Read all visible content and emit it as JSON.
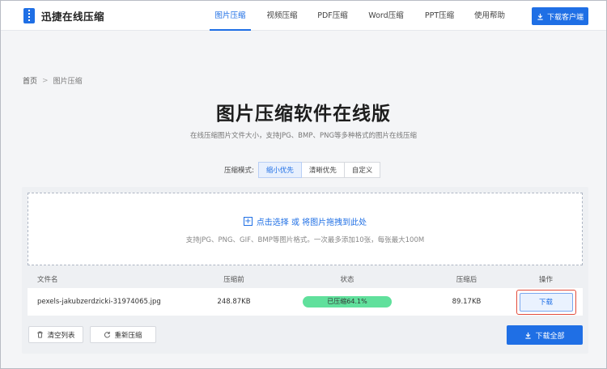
{
  "header": {
    "logo_text": "迅捷在线压缩",
    "nav": [
      {
        "label": "图片压缩",
        "active": true
      },
      {
        "label": "视频压缩",
        "active": false
      },
      {
        "label": "PDF压缩",
        "active": false
      },
      {
        "label": "Word压缩",
        "active": false
      },
      {
        "label": "PPT压缩",
        "active": false
      },
      {
        "label": "使用帮助",
        "active": false
      }
    ],
    "download_client_label": "下载客户端"
  },
  "breadcrumb": {
    "home": "首页",
    "separator": ">",
    "current": "图片压缩"
  },
  "page_title": "图片压缩软件在线版",
  "subtitle": "在线压缩图片文件大小，支持JPG、BMP、PNG等多种格式的图片在线压缩",
  "mode": {
    "label": "压缩模式:",
    "options": [
      "缩小优先",
      "清晰优先",
      "自定义"
    ],
    "selected": "缩小优先"
  },
  "upload": {
    "action_text": "点击选择 或 将图片拖拽到此处",
    "tip": "支持JPG、PNG、GIF、BMP等图片格式。一次最多添加10张，每张最大100M"
  },
  "table": {
    "headers": [
      "文件名",
      "压缩前",
      "状态",
      "压缩后",
      "操作"
    ],
    "rows": [
      {
        "filename": "pexels-jakubzerdzicki-31974065.jpg",
        "before": "248.87KB",
        "status": "已压缩64.1%",
        "after": "89.17KB",
        "action": "下载"
      }
    ]
  },
  "footer": {
    "clear_label": "清空列表",
    "recompress_label": "重新压缩",
    "download_all_label": "下载全部"
  },
  "colors": {
    "accent": "#1f6fe5",
    "status_green": "#60e09c",
    "highlight_red": "#e24b3b"
  }
}
